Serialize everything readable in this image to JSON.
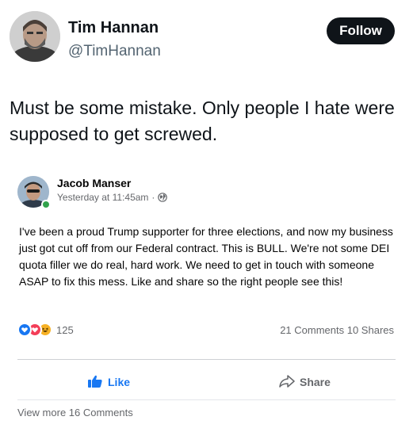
{
  "tweet": {
    "author_name": "Tim Hannan",
    "author_handle": "@TimHannan",
    "follow_label": "Follow",
    "text": "Must be some mistake.  Only people I hate were supposed to get screwed."
  },
  "fb_post": {
    "author_name": "Jacob Manser",
    "timestamp": "Yesterday at 11:45am",
    "meta_separator": "·",
    "privacy_icon": "globe-icon",
    "body": "I've been a proud Trump supporter for three elections, and now my business just got cut off from our Federal contract. This is BULL. We're not some DEI quota filler we do real, hard work. We need to get in touch with someone ASAP to fix this mess. Like and share so the right people see this!",
    "reaction_icons": [
      "care-icon",
      "love-icon",
      "haha-icon"
    ],
    "reaction_count": "125",
    "comments_shares": "21 Comments 10 Shares",
    "like_label": "Like",
    "share_label": "Share",
    "view_more_label": "View more 16 Comments"
  },
  "colors": {
    "follow_bg": "#0f1419",
    "fb_blue": "#1877f2",
    "muted": "#65676b",
    "online": "#31a24c"
  }
}
